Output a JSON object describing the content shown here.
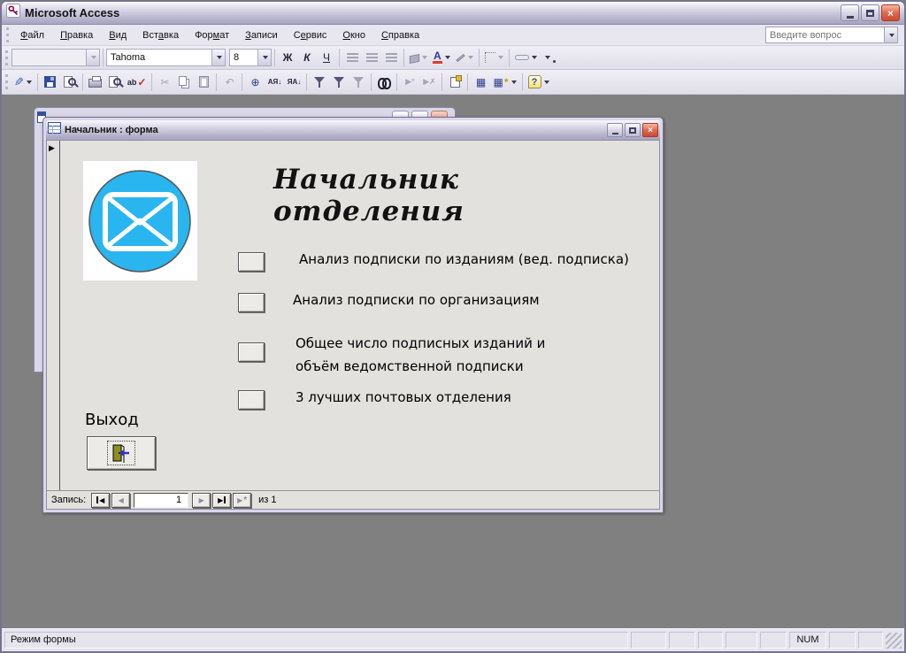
{
  "app": {
    "title": "Microsoft Access",
    "mode": "Режим формы",
    "num": "NUM"
  },
  "glyphs": {
    "close": "×",
    "tri_right": "▶",
    "tri_left": "◀",
    "star": "*"
  },
  "colors": {
    "mdi_background": "#808080",
    "chrome_silver": "#D0CEE0",
    "close_red": "#D95B41",
    "logo_cyan": "#29B5EF",
    "font_color_red": "#E23A2E"
  },
  "menubar": {
    "items": [
      {
        "pre": "",
        "key": "Ф",
        "post": "айл"
      },
      {
        "pre": "",
        "key": "П",
        "post": "равка"
      },
      {
        "pre": "",
        "key": "В",
        "post": "ид"
      },
      {
        "pre": "Вст",
        "key": "а",
        "post": "вка"
      },
      {
        "pre": "Фор",
        "key": "м",
        "post": "ат"
      },
      {
        "pre": "",
        "key": "З",
        "post": "аписи"
      },
      {
        "pre": "С",
        "key": "е",
        "post": "рвис"
      },
      {
        "pre": "",
        "key": "О",
        "post": "кно"
      },
      {
        "pre": "",
        "key": "С",
        "post": "правка"
      }
    ],
    "question_placeholder": "Введите вопрос"
  },
  "fmt": {
    "object_combo_value": "",
    "font": "Tahoma",
    "size": "8",
    "bold": "Ж",
    "italic": "К",
    "underline": "Ч",
    "font_color": "А"
  },
  "std": {
    "view": "✎",
    "spelling_ab": "ab",
    "spelling_check": "✓",
    "cut": "✂",
    "undo": "↶",
    "hyperlink": "⊕",
    "sort_asc": "АЯ↓",
    "sort_desc": "ЯА↓",
    "new_record": "▶*",
    "delete_record": "▶✗",
    "db_window": "▦",
    "new_object": "▦",
    "new_object_star": "*",
    "help": "?"
  },
  "form": {
    "title": "Начальник : форма",
    "heading": "Начальник отделения",
    "buttons": [
      {
        "label": "Анализ подписки по изданиям (вед. подписка)"
      },
      {
        "label": "Анализ подписки по организациям"
      },
      {
        "label": "Общее число подписных изданий и\nобъём ведомственной подписки"
      },
      {
        "label": "3 лучших почтовых отделения"
      }
    ],
    "exit_label": "Выход",
    "nav": {
      "label": "Запись:",
      "value": "1",
      "of": "из 1"
    }
  }
}
